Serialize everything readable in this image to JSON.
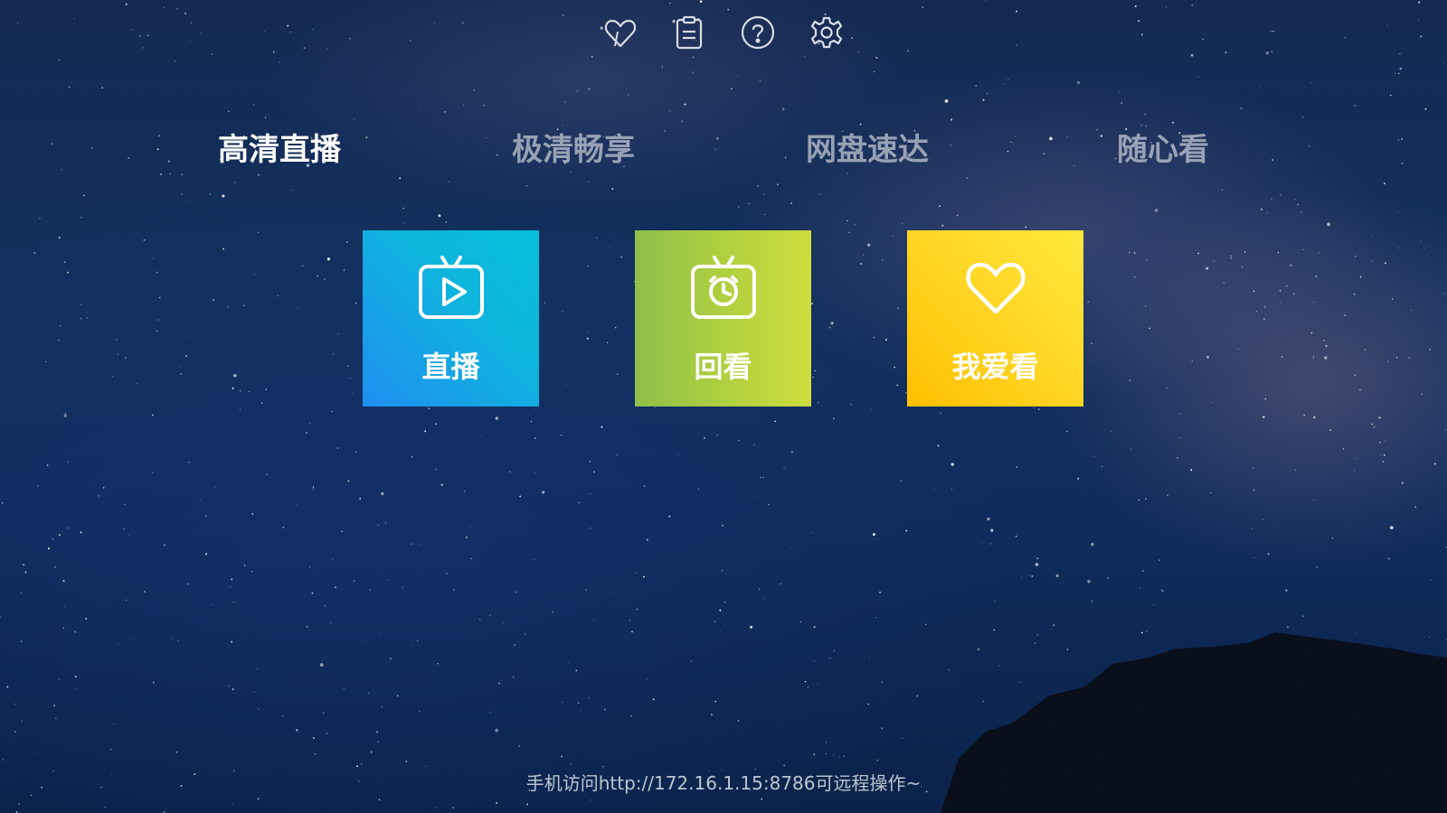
{
  "top_icons": [
    {
      "name": "favorite-heart-icon"
    },
    {
      "name": "clipboard-icon"
    },
    {
      "name": "help-icon"
    },
    {
      "name": "settings-gear-icon"
    }
  ],
  "tabs": [
    {
      "label": "高清直播",
      "active": true
    },
    {
      "label": "极清畅享",
      "active": false
    },
    {
      "label": "网盘速达",
      "active": false
    },
    {
      "label": "随心看",
      "active": false
    }
  ],
  "tiles": [
    {
      "label": "直播",
      "icon": "tv-play-icon"
    },
    {
      "label": "回看",
      "icon": "tv-clock-icon"
    },
    {
      "label": "我爱看",
      "icon": "heart-icon"
    }
  ],
  "footer": {
    "text": "手机访问http://172.16.1.15:8786可远程操作~"
  },
  "colors": {
    "live_tile": "#15a3e6",
    "replay_tile": "#acd042",
    "favorite_tile": "#ffd21e",
    "active_tab": "#ffffff",
    "inactive_tab": "#c8cdd7"
  }
}
